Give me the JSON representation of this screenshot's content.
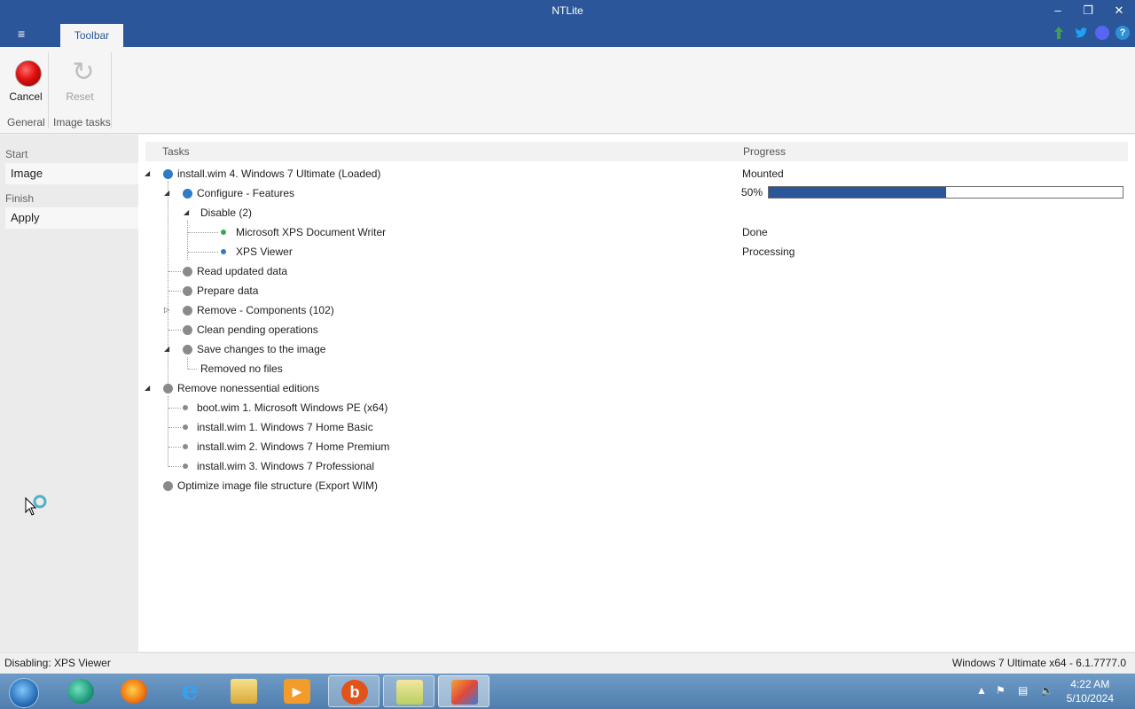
{
  "window": {
    "title": "NTLite"
  },
  "window_controls": {
    "minimize": "–",
    "restore": "❐",
    "close": "✕"
  },
  "ribbon": {
    "tab": "Toolbar",
    "cancel_label": "Cancel",
    "reset_label": "Reset",
    "groups": [
      "General",
      "Image tasks"
    ]
  },
  "nav": {
    "start_heading": "Start",
    "image_item": "Image",
    "finish_heading": "Finish",
    "apply_item": "Apply"
  },
  "columns": {
    "tasks": "Tasks",
    "progress": "Progress"
  },
  "tasks": [
    {
      "label": "install.wim 4. Windows 7 Ultimate  (Loaded)",
      "status": "Mounted"
    },
    {
      "label": "Configure - Features",
      "percent_text": "50%",
      "progress": 0.5
    },
    {
      "label": "Disable (2)"
    },
    {
      "label": "Microsoft XPS Document Writer",
      "status": "Done"
    },
    {
      "label": "XPS Viewer",
      "status": "Processing"
    },
    {
      "label": "Read updated data"
    },
    {
      "label": "Prepare data"
    },
    {
      "label": "Remove - Components (102)"
    },
    {
      "label": "Clean pending operations"
    },
    {
      "label": "Save changes to the image"
    },
    {
      "label": "Removed no files"
    },
    {
      "label": "Remove nonessential editions"
    },
    {
      "label": "boot.wim 1. Microsoft Windows PE (x64)"
    },
    {
      "label": "install.wim 1. Windows 7 Home Basic"
    },
    {
      "label": "install.wim 2. Windows 7 Home Premium"
    },
    {
      "label": "install.wim 3. Windows 7 Professional"
    },
    {
      "label": "Optimize image file structure (Export WIM)"
    }
  ],
  "statusbar": {
    "left": "Disabling: XPS Viewer",
    "right": "Windows 7 Ultimate x64 - 6.1.7777.0"
  },
  "taskbar": {
    "time": "4:22 AM",
    "date": "5/10/2024"
  },
  "colors": {
    "accent": "#2b579a",
    "dot_blue": "#2e7bc7",
    "dot_green": "#3aa655",
    "dot_grey": "#8a8a8a"
  }
}
